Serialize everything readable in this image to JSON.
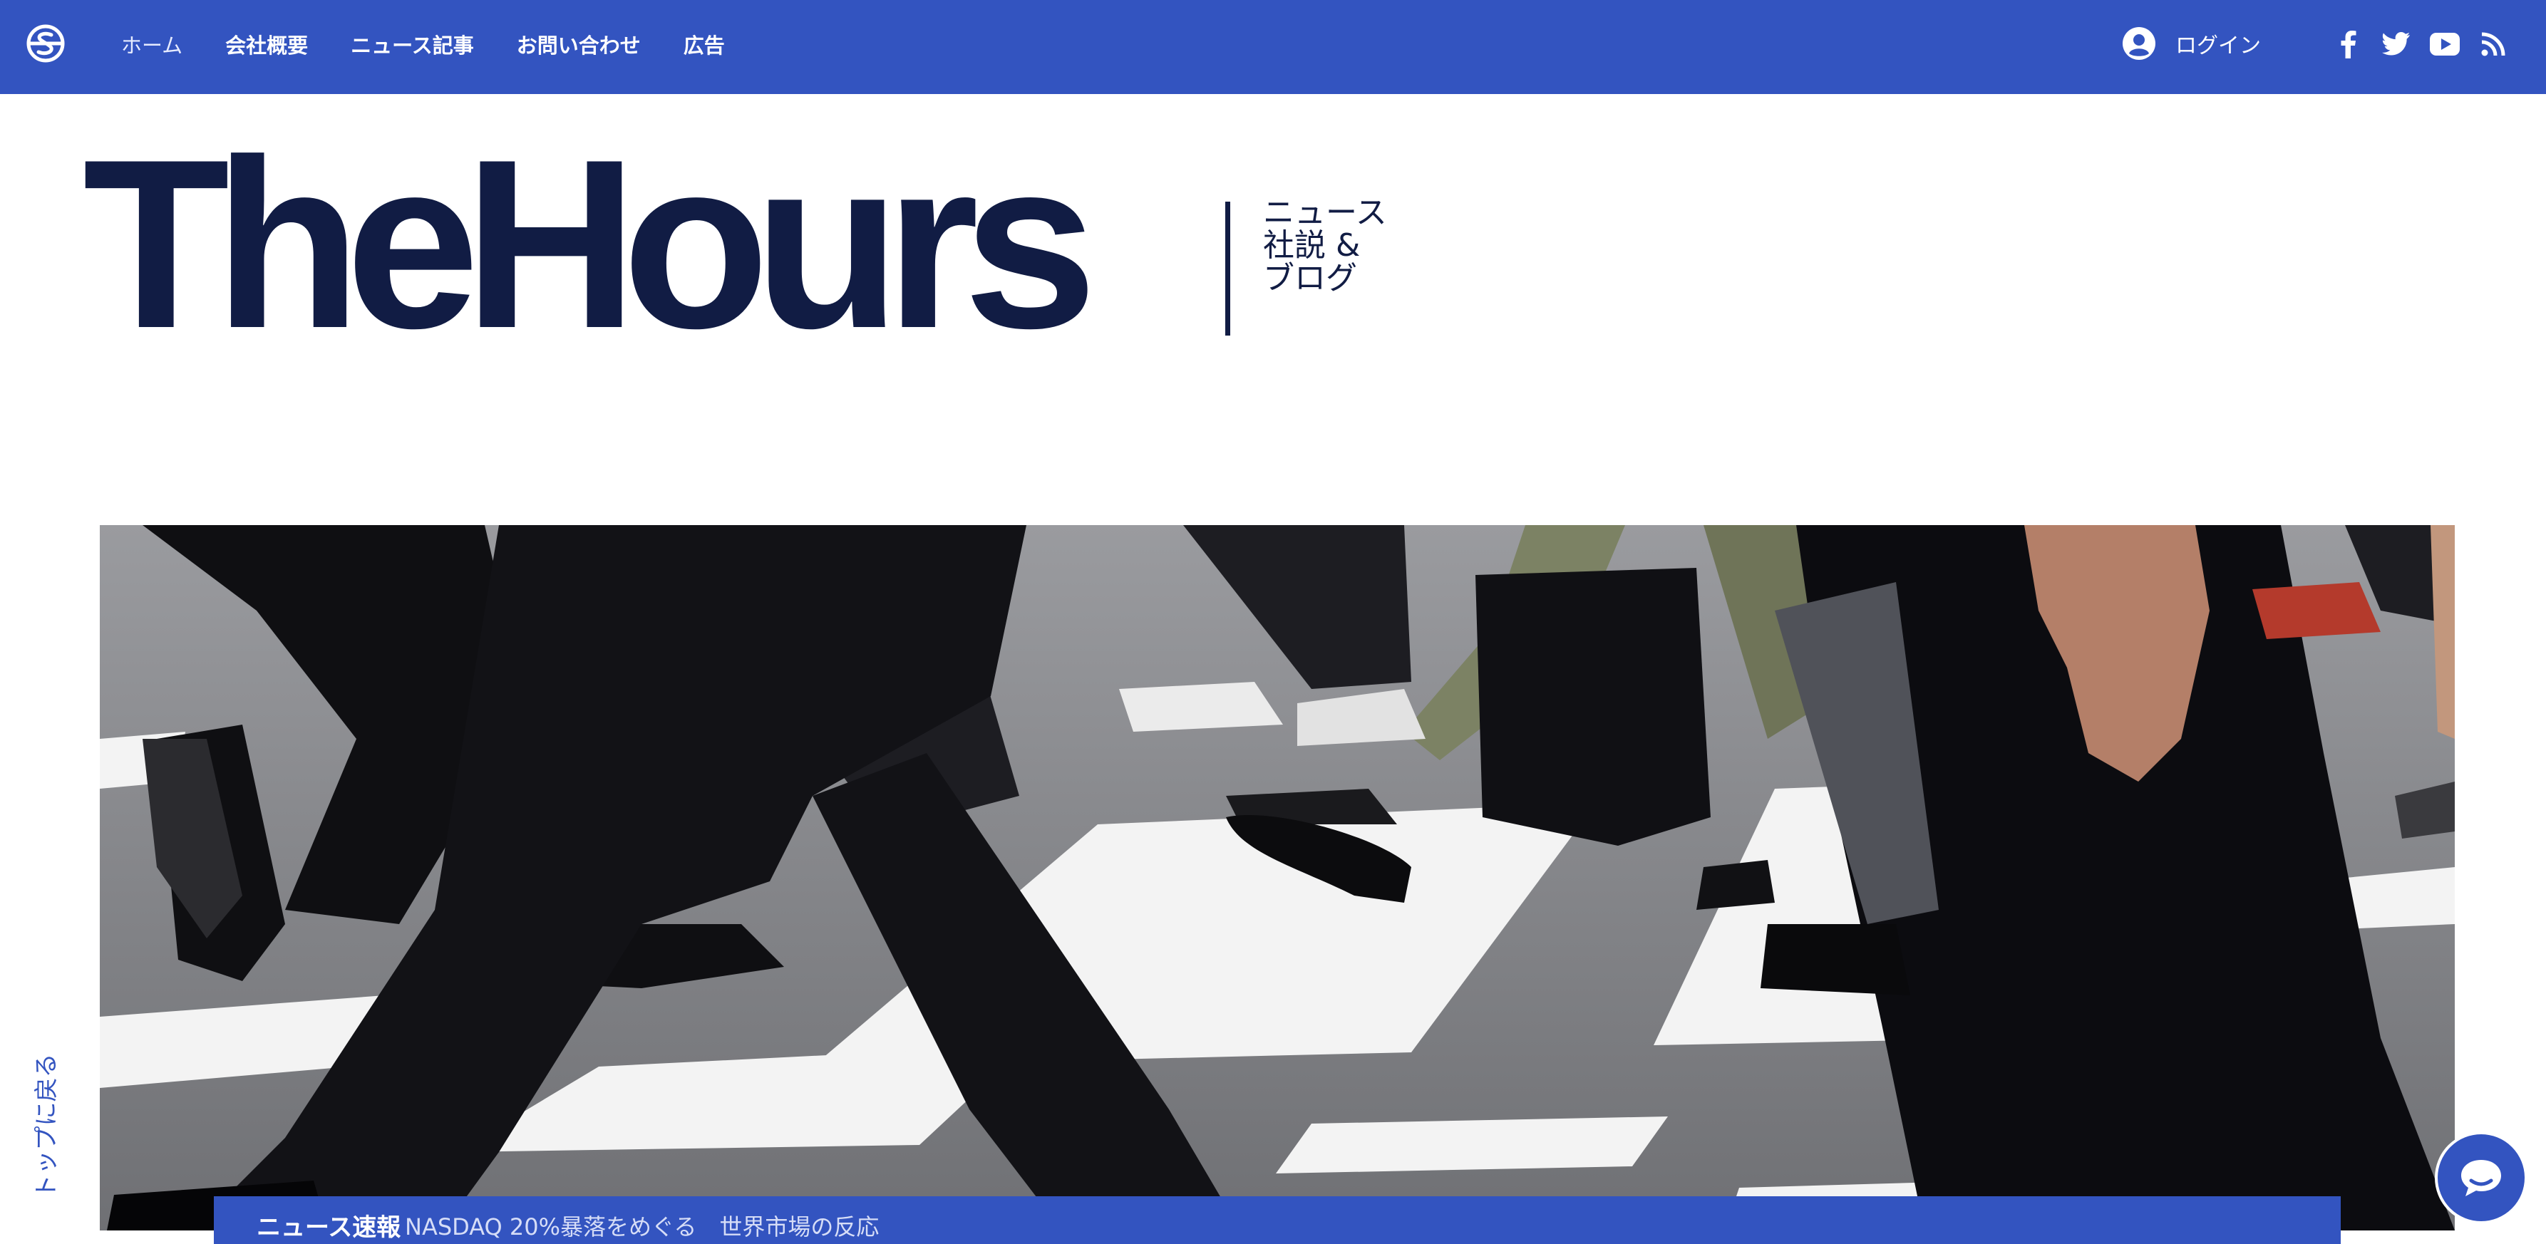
{
  "nav": {
    "logo": "site-logo-icon",
    "items": [
      {
        "label": "ホーム",
        "active": true
      },
      {
        "label": "会社概要"
      },
      {
        "label": "ニュース記事"
      },
      {
        "label": "お問い合わせ"
      },
      {
        "label": "広告"
      }
    ],
    "login_label": "ログイン",
    "social": [
      "facebook-icon",
      "twitter-icon",
      "youtube-icon",
      "rss-icon"
    ]
  },
  "masthead": {
    "title": "TheHours",
    "subtitle_lines": [
      "ニュース",
      "社説 &",
      "ブログ"
    ]
  },
  "hero": {
    "image": "people-walking-crosswalk-photo"
  },
  "back_to_top": "トップに戻る",
  "ticker": {
    "heading": "ニュース速報",
    "item": "NASDAQ 20%暴落をめぐる　世界市場の反応"
  },
  "chat": {
    "icon": "chat-bubble-icon"
  },
  "colors": {
    "brand_blue": "#3354c0",
    "masthead_navy": "#111c44"
  }
}
